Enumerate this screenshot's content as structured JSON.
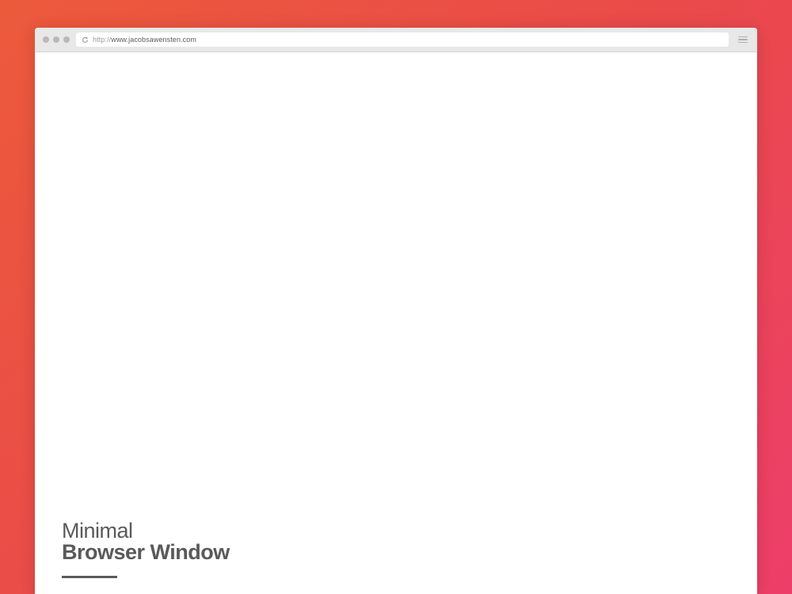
{
  "address_bar": {
    "url_prefix": "http://",
    "url_domain": "www.jacobsawensten.com"
  },
  "content": {
    "title_line1": "Minimal",
    "title_line2": "Browser Window"
  }
}
